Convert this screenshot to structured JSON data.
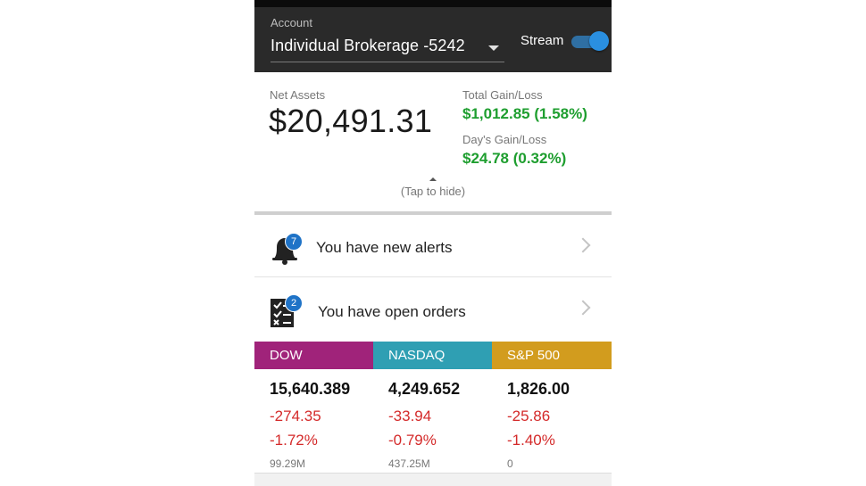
{
  "header": {
    "account_label": "Account",
    "account_value": "Individual Brokerage -5242",
    "stream_label": "Stream",
    "stream_on": true
  },
  "summary": {
    "net_assets_label": "Net Assets",
    "net_assets_value": "$20,491.31",
    "total_gain_label": "Total Gain/Loss",
    "total_gain_value": "$1,012.85 (1.58%)",
    "day_gain_label": "Day's Gain/Loss",
    "day_gain_value": "$24.78 (0.32%)",
    "tap_hide": "(Tap to hide)"
  },
  "alerts": {
    "text": "You have new alerts",
    "badge": "7",
    "icon": "bell-icon"
  },
  "orders": {
    "text": "You have open orders",
    "badge": "2",
    "icon": "checklist-icon"
  },
  "indices": [
    {
      "name": "DOW",
      "color": "#a0237a",
      "value": "15,640.389",
      "change": "-274.35",
      "percent": "-1.72%",
      "volume": "99.29M"
    },
    {
      "name": "NASDAQ",
      "color": "#2f9fb3",
      "value": "4,249.652",
      "change": "-33.94",
      "percent": "-0.79%",
      "volume": "437.25M"
    },
    {
      "name": "S&P 500",
      "color": "#d29c1e",
      "value": "1,826.00",
      "change": "-25.86",
      "percent": "-1.40%",
      "volume": "0"
    }
  ],
  "colors": {
    "gain": "#1e9e2f",
    "loss": "#d42a2a",
    "header_bg": "#2a2a2a",
    "accent": "#2a8fe0"
  }
}
